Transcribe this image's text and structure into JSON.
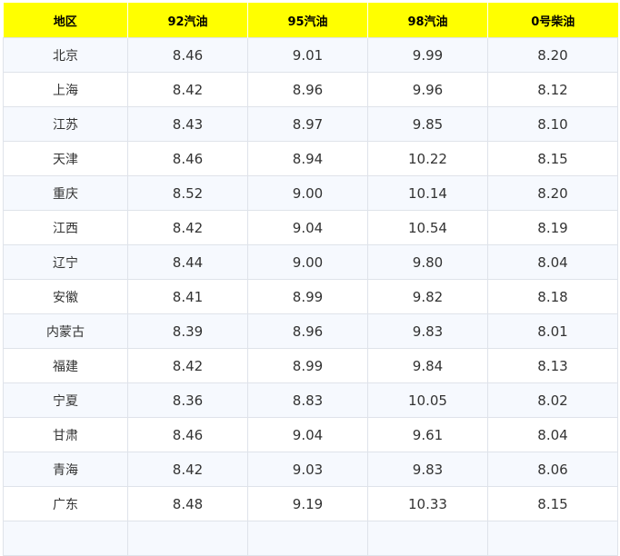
{
  "table": {
    "headers": [
      "地区",
      "92汽油",
      "95汽油",
      "98汽油",
      "0号柴油"
    ],
    "rows": [
      [
        "北京",
        "8.46",
        "9.01",
        "9.99",
        "8.20"
      ],
      [
        "上海",
        "8.42",
        "8.96",
        "9.96",
        "8.12"
      ],
      [
        "江苏",
        "8.43",
        "8.97",
        "9.85",
        "8.10"
      ],
      [
        "天津",
        "8.46",
        "8.94",
        "10.22",
        "8.15"
      ],
      [
        "重庆",
        "8.52",
        "9.00",
        "10.14",
        "8.20"
      ],
      [
        "江西",
        "8.42",
        "9.04",
        "10.54",
        "8.19"
      ],
      [
        "辽宁",
        "8.44",
        "9.00",
        "9.80",
        "8.04"
      ],
      [
        "安徽",
        "8.41",
        "8.99",
        "9.82",
        "8.18"
      ],
      [
        "内蒙古",
        "8.39",
        "8.96",
        "9.83",
        "8.01"
      ],
      [
        "福建",
        "8.42",
        "8.99",
        "9.84",
        "8.13"
      ],
      [
        "宁夏",
        "8.36",
        "8.83",
        "10.05",
        "8.02"
      ],
      [
        "甘肃",
        "8.46",
        "9.04",
        "9.61",
        "8.04"
      ],
      [
        "青海",
        "8.42",
        "9.03",
        "9.83",
        "8.06"
      ],
      [
        "广东",
        "8.48",
        "9.19",
        "10.33",
        "8.15"
      ],
      [
        "",
        "",
        "",
        "",
        ""
      ]
    ]
  },
  "colors": {
    "header_background": "#ffff00",
    "row_stripe": "#f6f9fe",
    "border": "#dfe3ea"
  }
}
